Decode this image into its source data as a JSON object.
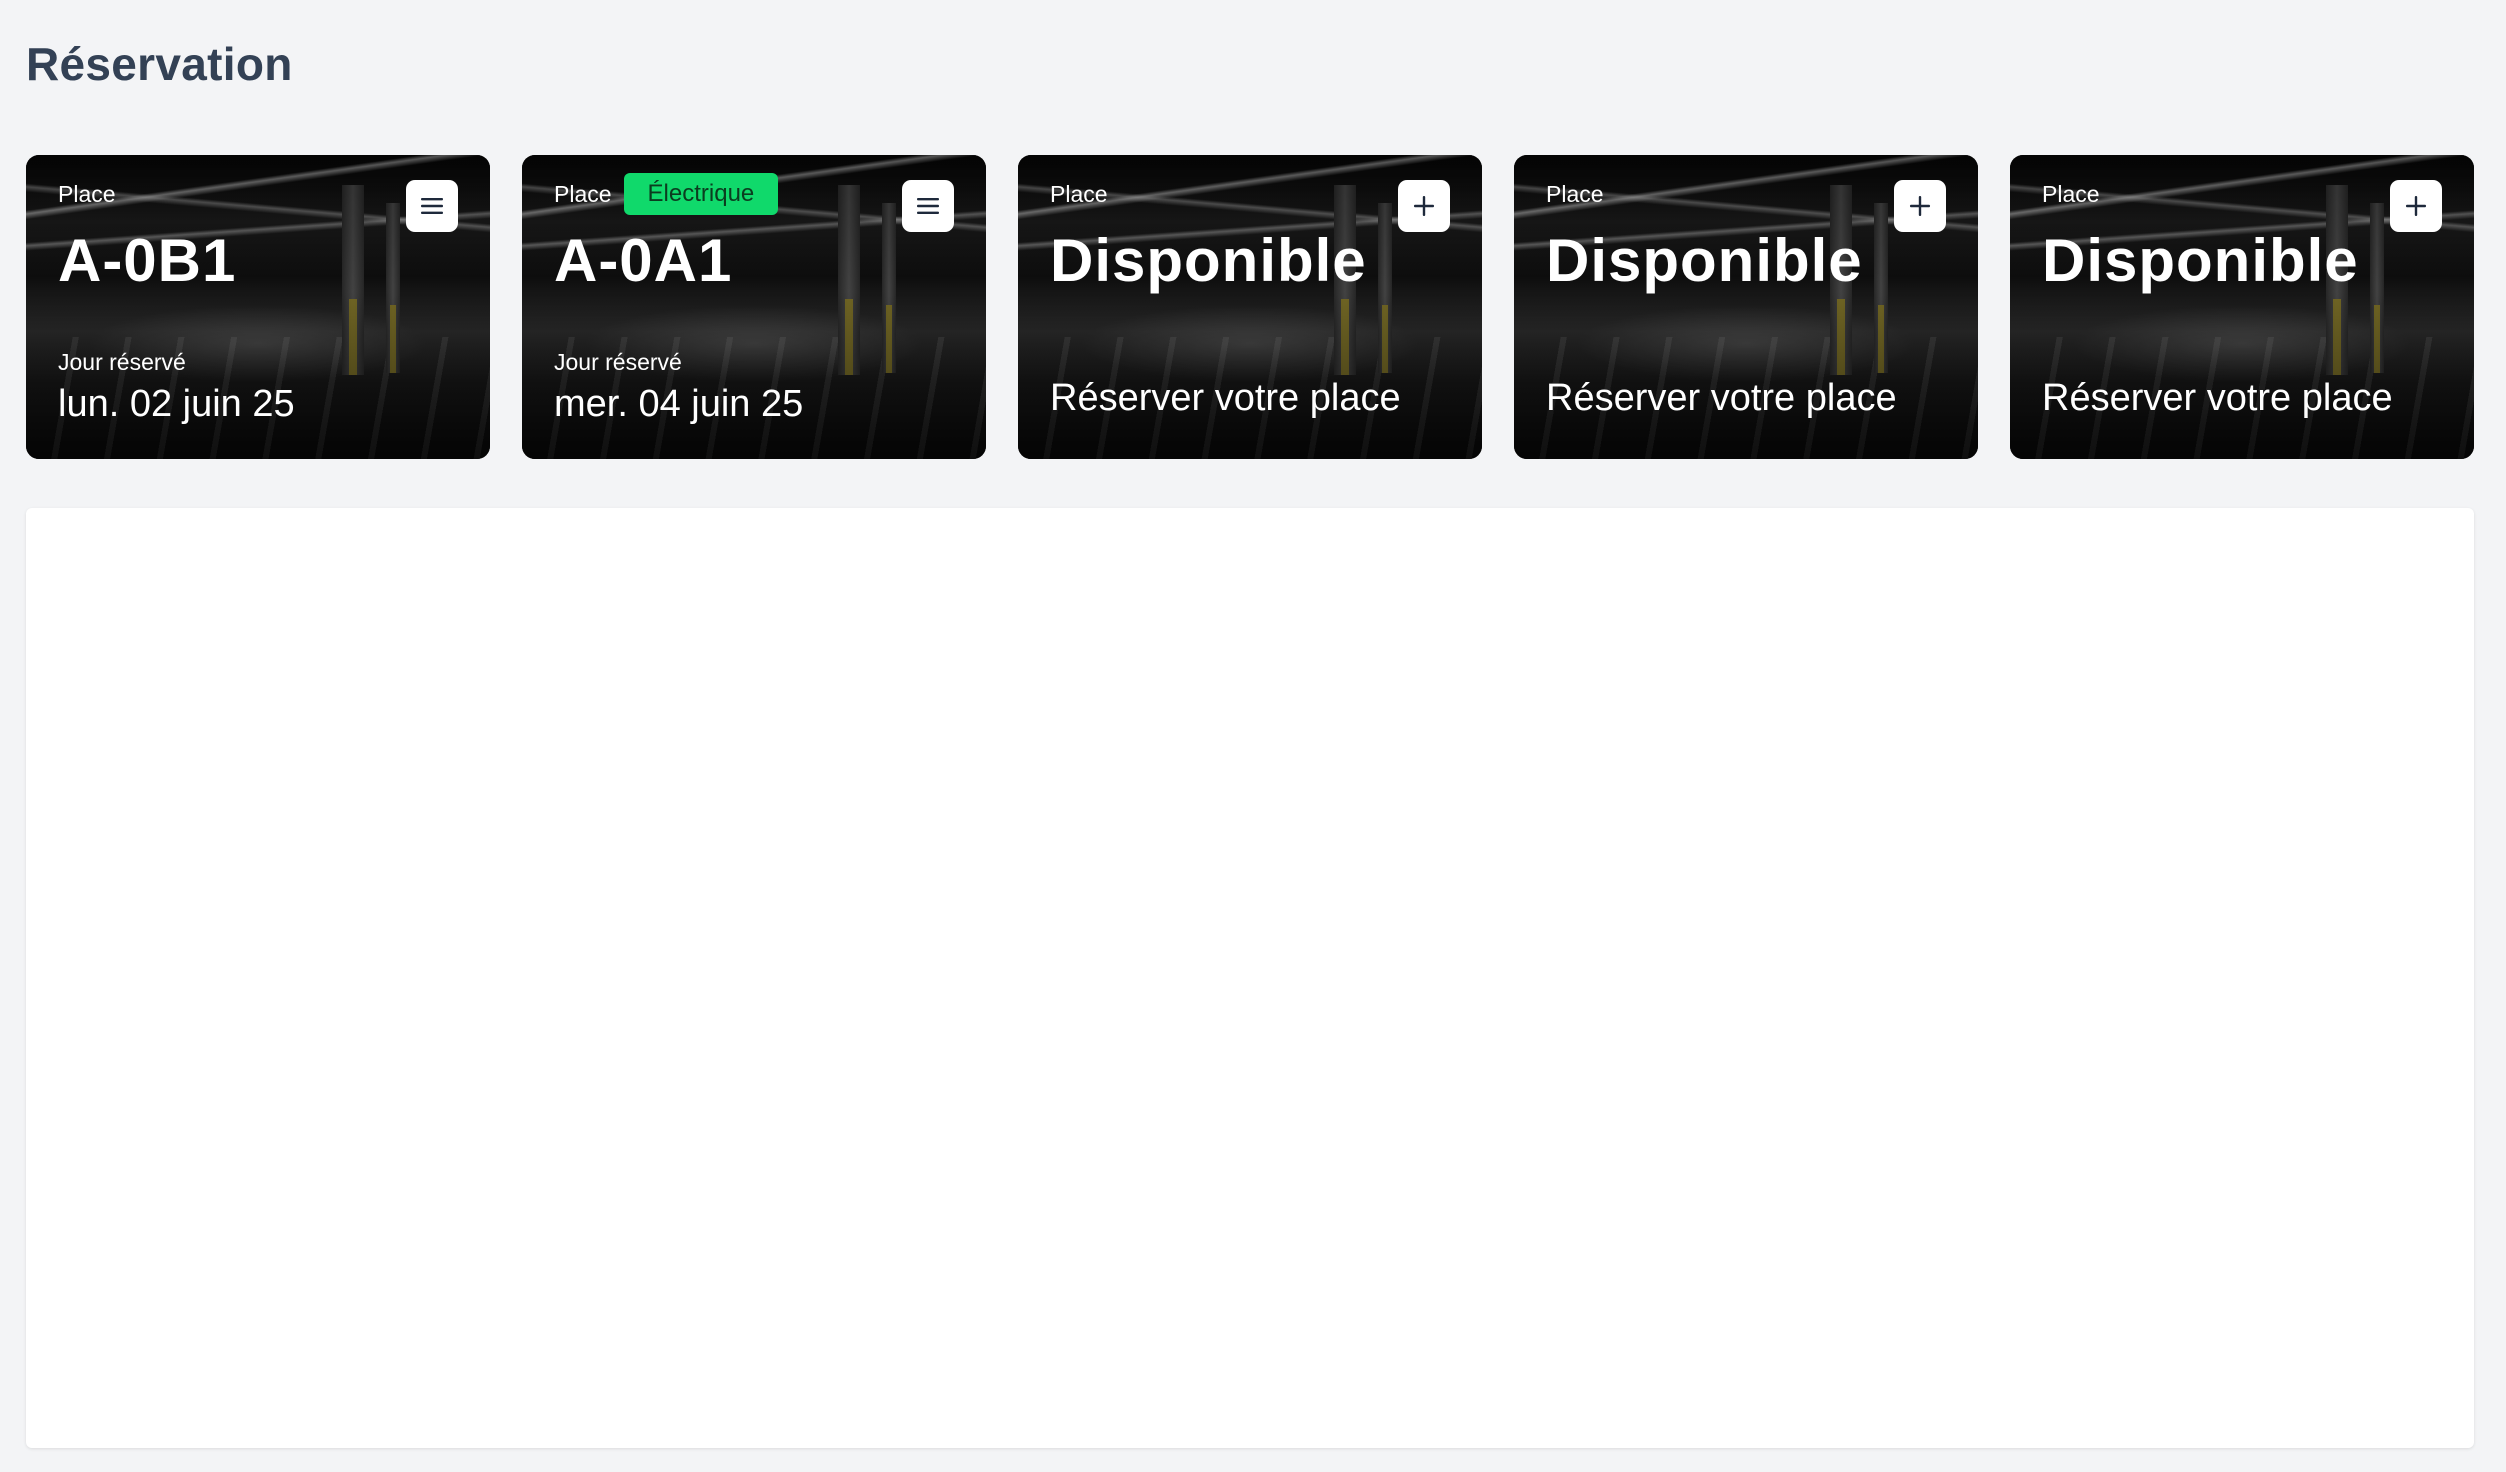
{
  "page": {
    "title": "Réservation"
  },
  "cards": [
    {
      "place_label": "Place",
      "badge": "",
      "title": "A-0B1",
      "sub_label": "Jour réservé",
      "sub_value": "lun. 02 juin 25",
      "action_icon": "menu-icon"
    },
    {
      "place_label": "Place",
      "badge": "Électrique",
      "title": "A-0A1",
      "sub_label": "Jour réservé",
      "sub_value": "mer. 04 juin 25",
      "action_icon": "menu-icon"
    },
    {
      "place_label": "Place",
      "badge": "",
      "title": "Disponible",
      "reserve_text": "Réserver votre place",
      "action_icon": "plus-icon"
    },
    {
      "place_label": "Place",
      "badge": "",
      "title": "Disponible",
      "reserve_text": "Réserver votre place",
      "action_icon": "plus-icon"
    },
    {
      "place_label": "Place",
      "badge": "",
      "title": "Disponible",
      "reserve_text": "Réserver votre place",
      "action_icon": "plus-icon"
    }
  ],
  "colors": {
    "page_background": "#f3f4f6",
    "title_color": "#334155",
    "badge_background": "#10d96b",
    "panel_background": "#ffffff"
  }
}
